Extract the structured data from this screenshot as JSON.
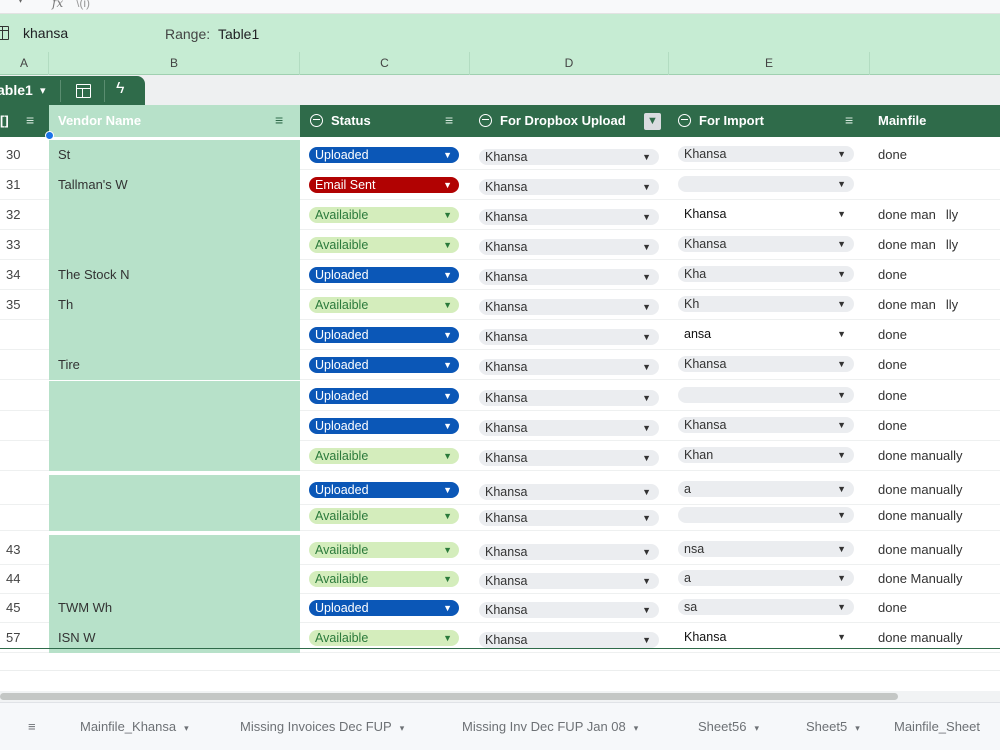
{
  "formula_bar": {
    "fx_label": "fx",
    "formula": "\\(i)"
  },
  "name_bar": {
    "cell_name": "khansa",
    "range_label": "Range:",
    "range_value": "Table1"
  },
  "column_headers": [
    "A",
    "B",
    "C",
    "D",
    "E"
  ],
  "table_tab": {
    "name": "able1"
  },
  "table_header": {
    "id": "[]",
    "vendor": "Vendor Name",
    "status": "Status",
    "dropbox": "For Dropbox Upload",
    "import": "For Import",
    "main": "Mainfile"
  },
  "rows": [
    {
      "id": "30",
      "vendor": "St",
      "status": "Uploaded",
      "dropbox": "Khansa",
      "import": "Khansa",
      "main": "done"
    },
    {
      "id": "31",
      "vendor": "Tallman's W",
      "status": "Email Sent",
      "dropbox": "Khansa",
      "import": "",
      "main": ""
    },
    {
      "id": "32",
      "vendor": "",
      "status": "Availaible",
      "dropbox": "Khansa",
      "import": "Khansa",
      "main": "done man",
      "main_tail": "lly"
    },
    {
      "id": "33",
      "vendor": "",
      "status": "Availaible",
      "dropbox": "Khansa",
      "import": "Khansa",
      "main": "done man",
      "main_tail": "lly"
    },
    {
      "id": "34",
      "vendor": "The Stock N",
      "status": "Uploaded",
      "dropbox": "Khansa",
      "import": "Kha",
      "main": "done"
    },
    {
      "id": "35",
      "vendor": "Th",
      "status": "Availaible",
      "dropbox": "Khansa",
      "import": "Kh",
      "main": "done man",
      "main_tail": "lly"
    },
    {
      "id": "",
      "vendor": "",
      "status": "Uploaded",
      "dropbox": "Khansa",
      "import": "ansa",
      "main": "done"
    },
    {
      "id": "",
      "vendor": "Tire",
      "status": "Uploaded",
      "dropbox": "Khansa",
      "import": "Khansa",
      "main": "done"
    },
    {
      "id": "",
      "vendor": "",
      "status": "Uploaded",
      "dropbox": "Khansa",
      "import": "",
      "main": "done"
    },
    {
      "id": "",
      "vendor": "",
      "status": "Uploaded",
      "dropbox": "Khansa",
      "import": "Khansa",
      "main": "done"
    },
    {
      "id": "",
      "vendor": "",
      "status": "Availaible",
      "dropbox": "Khansa",
      "import": "Khan",
      "main": "done manually"
    },
    {
      "id": "",
      "vendor": "",
      "status": "Uploaded",
      "dropbox": "Khansa",
      "import": "a",
      "main": "done manually"
    },
    {
      "id": "",
      "vendor": "",
      "status": "Availaible",
      "dropbox": "Khansa",
      "import": "",
      "main": "done manually"
    },
    {
      "id": "43",
      "vendor": "",
      "status": "Availaible",
      "dropbox": "Khansa",
      "import": "nsa",
      "main": "done manually"
    },
    {
      "id": "44",
      "vendor": "",
      "status": "Availaible",
      "dropbox": "Khansa",
      "import": "a",
      "main": "done Manually"
    },
    {
      "id": "45",
      "vendor": "TWM Wh",
      "status": "Uploaded",
      "dropbox": "Khansa",
      "import": "sa",
      "main": "done"
    },
    {
      "id": "57",
      "vendor": "ISN W",
      "status": "Availaible",
      "dropbox": "Khansa",
      "import": "Khansa",
      "main": "done manually"
    }
  ],
  "status_colors": {
    "Uploaded": "#0b57b7",
    "Availaible": "#d4edbc",
    "Email Sent": "#b10202"
  },
  "sheet_tabs": [
    "",
    "Mainfile_Khansa",
    "Missing Invoices Dec FUP",
    "Missing Inv Dec FUP Jan 08",
    "Sheet56",
    "Sheet5",
    "Mainfile_Sheet"
  ]
}
